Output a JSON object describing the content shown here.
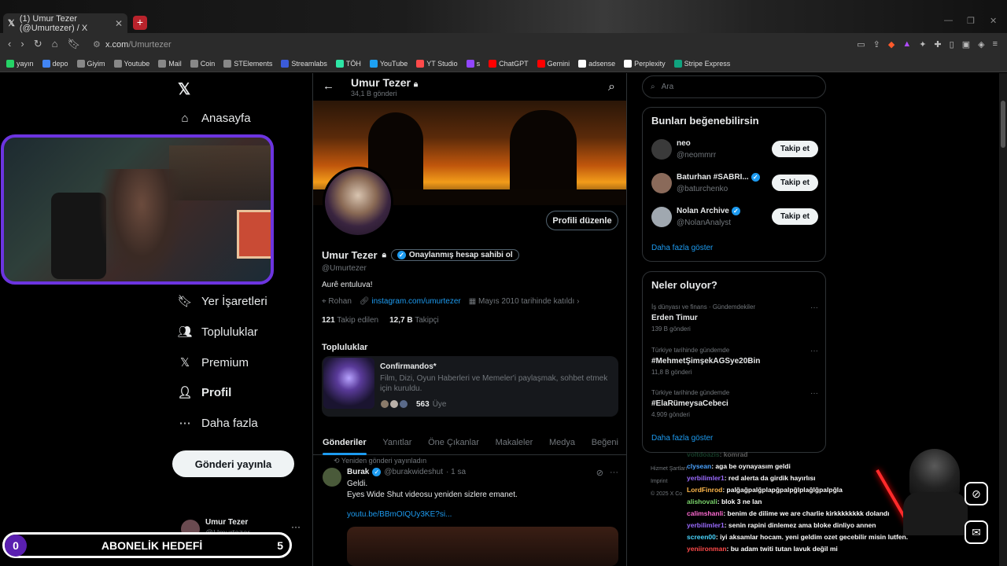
{
  "browser": {
    "tab_title": "(1) Umur Tezer (@Umurtezer) / X",
    "url_domain": "x.com",
    "url_path": "/Umurtezer",
    "bookmarks": [
      "yayın",
      "depo",
      "Giyim",
      "Youtube",
      "Mail",
      "Coin",
      "STElements",
      "Streamlabs",
      "TÖH",
      "YouTube",
      "YT Studio",
      "s",
      "ChatGPT",
      "Gemini",
      "adsense",
      "Perplexity",
      "Stripe Express"
    ]
  },
  "nav": {
    "home": "Anasayfa",
    "bookmarks": "Yer İşaretleri",
    "communities": "Topluluklar",
    "premium": "Premium",
    "profile": "Profil",
    "more": "Daha fazla",
    "post_button": "Gönderi yayınla",
    "me_name": "Umur Tezer",
    "me_handle": "@Umurtezer"
  },
  "header": {
    "name": "Umur Tezer",
    "post_count": "34,1 B gönderi"
  },
  "profile": {
    "edit_button": "Profili düzenle",
    "name": "Umur Tezer",
    "verify_label": "Onaylanmış hesap sahibi ol",
    "handle": "@Umurtezer",
    "bio": "Aurê entuluva!",
    "location": "Rohan",
    "link": "instagram.com/umurtezer",
    "joined": "Mayıs 2010 tarihinde katıldı",
    "following_count": "121",
    "following_label": "Takip edilen",
    "followers_count": "12,7 B",
    "followers_label": "Takipçi"
  },
  "communities": {
    "title": "Topluluklar",
    "name": "Confirmandos*",
    "description": "Film, Dizi, Oyun Haberleri ve Memeler'i paylaşmak, sohbet etmek için kuruldu.",
    "members": "563",
    "members_label": "Üye"
  },
  "tabs": [
    "Gönderiler",
    "Yanıtlar",
    "Öne Çıkanlar",
    "Makaleler",
    "Medya",
    "Beğeni"
  ],
  "tweet": {
    "repost_label": "Yeniden gönderi yayınladın",
    "author": "Burak",
    "handle": "@burakwideshut",
    "time": "· 1 sa",
    "line1": "Geldi.",
    "line2": "Eyes Wide Shut videosu yeniden sizlere emanet.",
    "link": "youtu.be/BBmOIQUy3KE?si..."
  },
  "right": {
    "search_placeholder": "Ara",
    "suggest_title": "Bunları beğenebilirsin",
    "suggestions": [
      {
        "name": "neo",
        "handle": "@neommrr",
        "button": "Takip et"
      },
      {
        "name": "Baturhan #SABRI...",
        "handle": "@baturchenko",
        "button": "Takip et"
      },
      {
        "name": "Nolan Archive",
        "handle": "@NolanAnalyst",
        "button": "Takip et"
      }
    ],
    "show_more": "Daha fazla göster",
    "trends_title": "Neler oluyor?",
    "trends": [
      {
        "category": "İş dünyası ve finans · Gündemdekiler",
        "name": "Erden Timur",
        "count": "139 B gönderi"
      },
      {
        "category": "Türkiye tarihinde gündemde",
        "name": "#MehmetŞimşekAGSye20Bin",
        "count": "11,8 B gönderi"
      },
      {
        "category": "Türkiye tarihinde gündemde",
        "name": "#ElaRümeysaCebeci",
        "count": "4.909 gönderi"
      }
    ],
    "trends_more": "Daha fazla göster",
    "footer1": "Hizmet Şartları",
    "footer2": "Imprint",
    "footer3": "© 2025 X Co"
  },
  "overlay": {
    "sub_goal_label": "ABONELİK HEDEFİ",
    "sub_goal_current": "0",
    "sub_goal_target": "5",
    "chat": [
      {
        "user": "voltdoazis",
        "text": ": komrad",
        "color": "#3aa76d"
      },
      {
        "user": "clysean",
        "text": ": aga be oynayasım geldi",
        "color": "#4aa3ff"
      },
      {
        "user": "yerbilimler1",
        "text": ": red alerta da girdik hayırlısı",
        "color": "#9b6bff"
      },
      {
        "user": "LordFinrod",
        "text": ": palğağpalğplapğpalpğlplağlğpalpğla",
        "color": "#ffb84a"
      },
      {
        "user": "alishovali",
        "text": ": blok 3 ne lan",
        "color": "#7ad36b"
      },
      {
        "user": "calimshanli",
        "text": ": benim de dilime we are charlie kirkkkkkkkk dolandı",
        "color": "#ff6bd2"
      },
      {
        "user": "yerbilimler1",
        "text": ": senin rapini dinlemez ama bloke dinliyo annen",
        "color": "#9b6bff"
      },
      {
        "user": "screen00",
        "text": ": iyi aksamlar hocam. yeni geldim ozet gecebilir misin lutfen.",
        "color": "#4ad6ff"
      },
      {
        "user": "yeniironman",
        "text": ": bu adam twiti tutan lavuk değil mi",
        "color": "#ff4a4a"
      }
    ]
  }
}
